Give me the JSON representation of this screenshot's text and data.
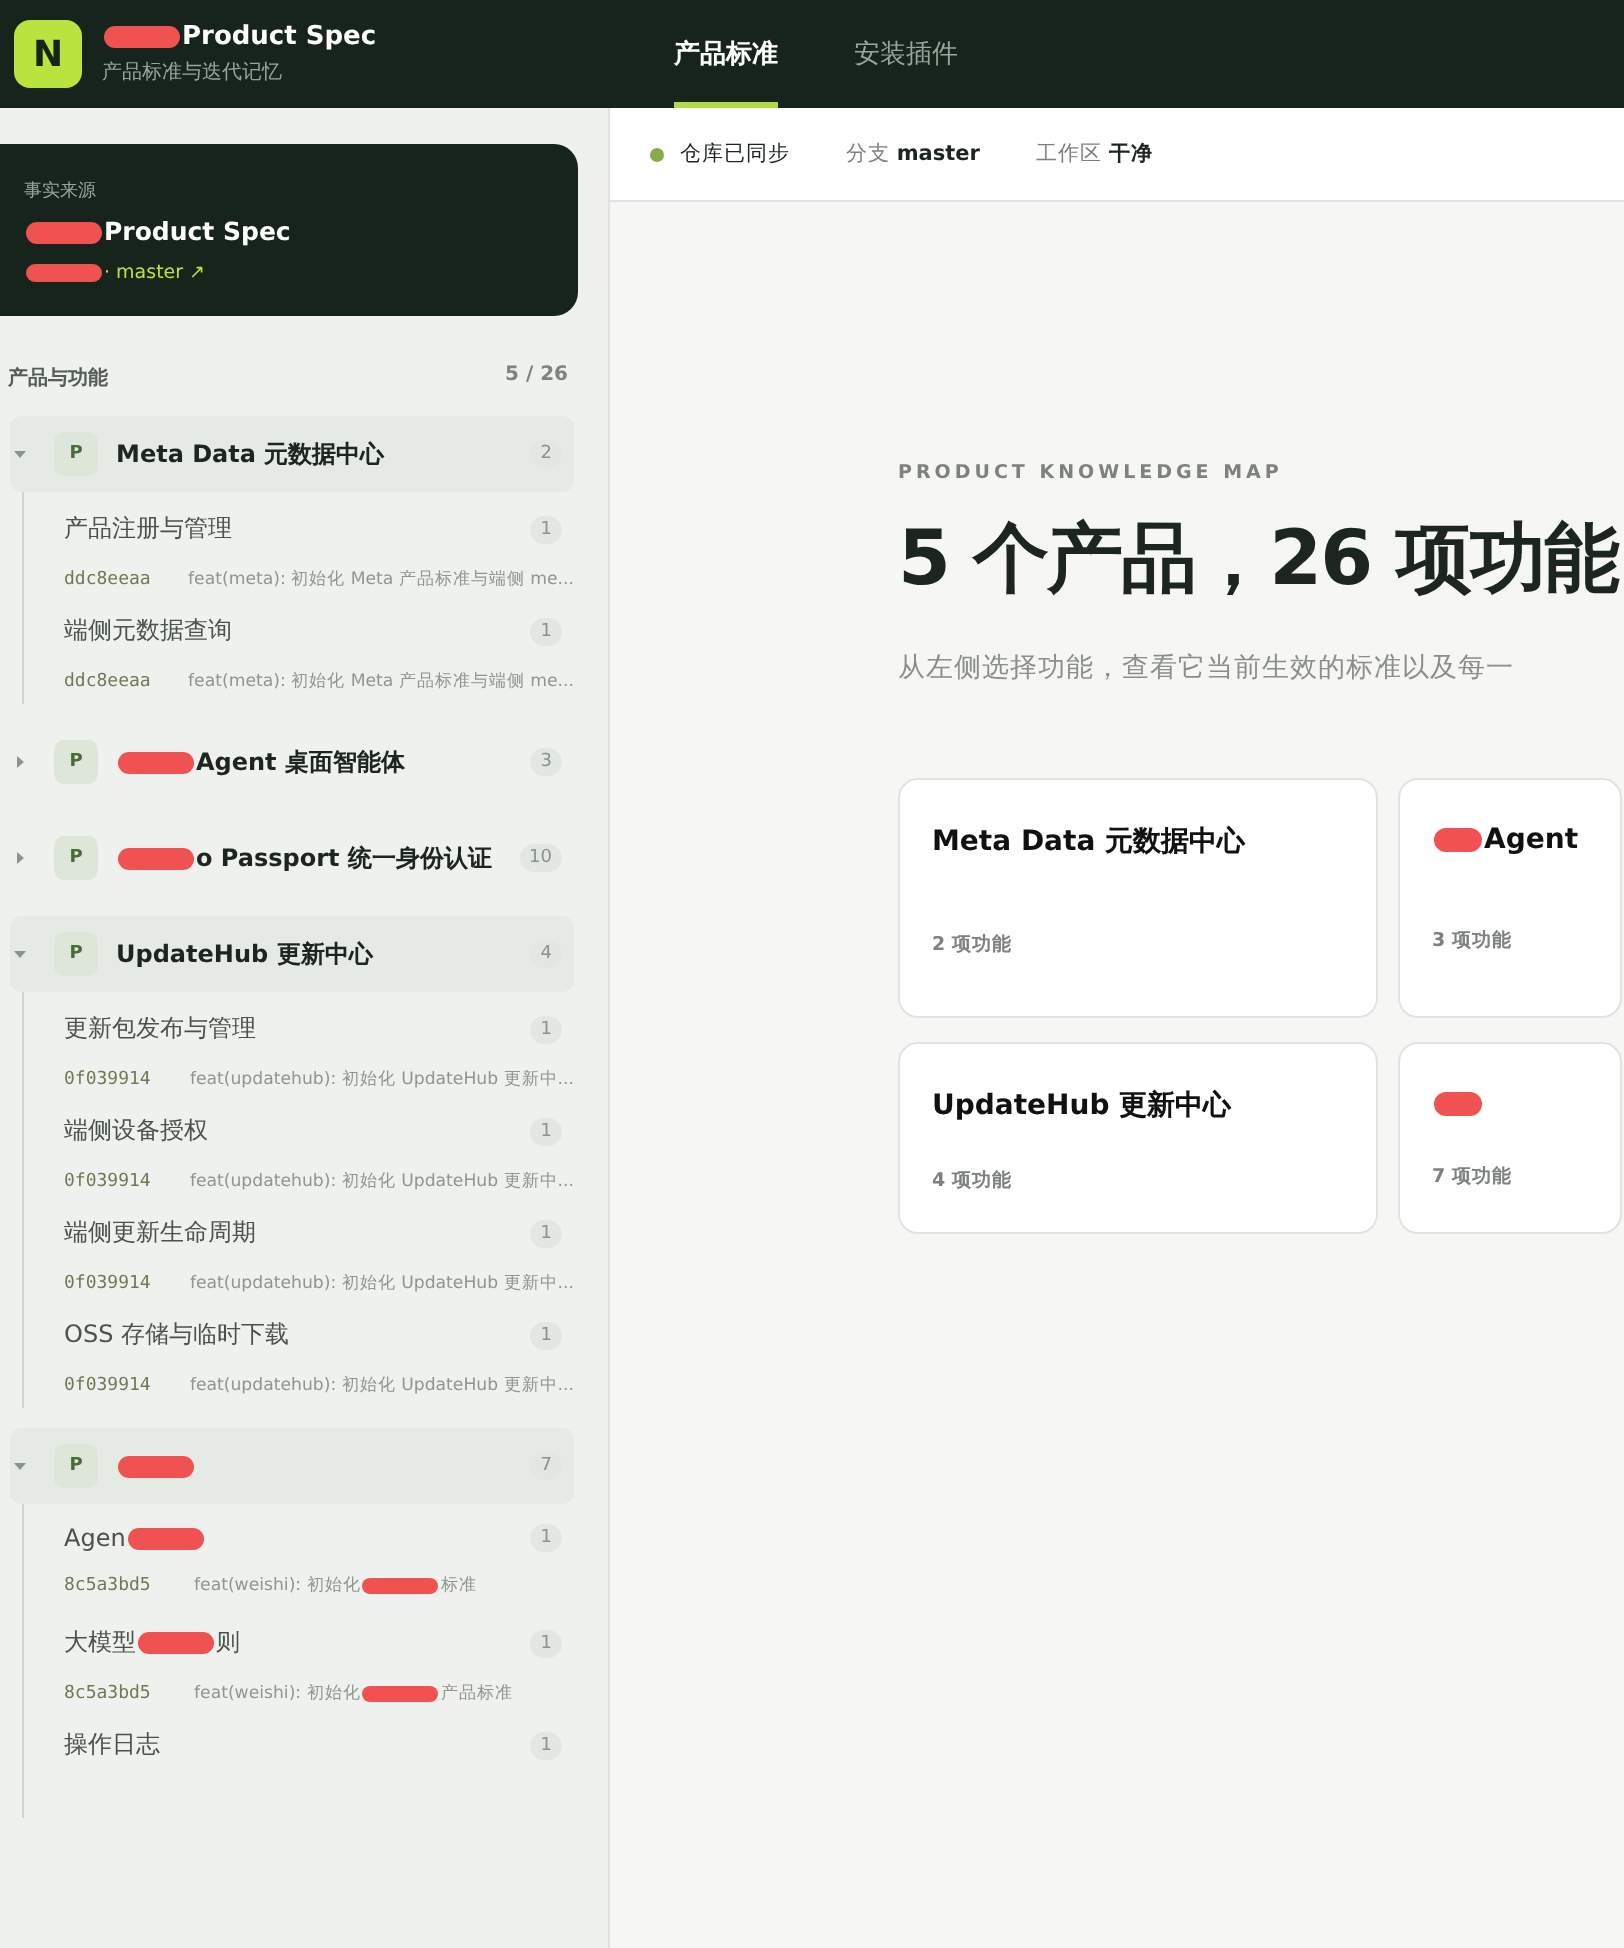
{
  "header": {
    "logo": "N",
    "title": [
      {
        "kind": "redaction"
      },
      "Product Spec"
    ],
    "subtitle": "产品标准与迭代记忆"
  },
  "tabs": [
    {
      "label": "产品标准",
      "selected": true
    },
    {
      "label": "安装插件",
      "selected": false
    }
  ],
  "source_card": {
    "label": "事实来源",
    "title": [
      {
        "kind": "redaction"
      },
      "Product Spec"
    ],
    "branch": [
      {
        "kind": "redaction"
      },
      "· master ↗"
    ]
  },
  "tree_header": {
    "title": "产品与功能",
    "count": "5 / 26"
  },
  "products": [
    {
      "badge": "P",
      "name": [
        "Meta Data 元数据中心"
      ],
      "count": "2",
      "expanded": true,
      "children": [
        {
          "name": [
            "产品注册与管理"
          ],
          "count": "1",
          "hash": "ddc8eeaa",
          "message": [
            "feat(meta): 初始化 Meta 产品标准与端侧 me..."
          ]
        },
        {
          "name": [
            "端侧元数据查询"
          ],
          "count": "1",
          "hash": "ddc8eeaa",
          "message": [
            "feat(meta): 初始化 Meta 产品标准与端侧 me..."
          ]
        }
      ]
    },
    {
      "badge": "P",
      "name": [
        {
          "kind": "redaction"
        },
        "Agent 桌面智能体"
      ],
      "count": "3",
      "expanded": false
    },
    {
      "badge": "P",
      "name": [
        {
          "kind": "redaction"
        },
        "o Passport 统一身份认证"
      ],
      "count": "10",
      "expanded": false
    },
    {
      "badge": "P",
      "name": [
        "UpdateHub 更新中心"
      ],
      "count": "4",
      "expanded": true,
      "children": [
        {
          "name": [
            "更新包发布与管理"
          ],
          "count": "1",
          "hash": "0f039914",
          "message": [
            "feat(updatehub): 初始化 UpdateHub 更新中..."
          ]
        },
        {
          "name": [
            "端侧设备授权"
          ],
          "count": "1",
          "hash": "0f039914",
          "message": [
            "feat(updatehub): 初始化 UpdateHub 更新中..."
          ]
        },
        {
          "name": [
            "端侧更新生命周期"
          ],
          "count": "1",
          "hash": "0f039914",
          "message": [
            "feat(updatehub): 初始化 UpdateHub 更新中..."
          ]
        },
        {
          "name": [
            "OSS 存储与临时下载"
          ],
          "count": "1",
          "hash": "0f039914",
          "message": [
            "feat(updatehub): 初始化 UpdateHub 更新中..."
          ]
        }
      ]
    },
    {
      "badge": "P",
      "name": [
        {
          "kind": "redaction"
        }
      ],
      "count": "7",
      "expanded": true,
      "children": [
        {
          "name": [
            "Agen",
            {
              "kind": "redaction"
            }
          ],
          "count": "1",
          "hash": "8c5a3bd5",
          "message": [
            "feat(weishi): 初始化",
            {
              "kind": "redaction"
            },
            "标准"
          ]
        },
        {
          "name": [
            "大模型",
            {
              "kind": "redaction"
            },
            "则"
          ],
          "count": "1",
          "hash": "8c5a3bd5",
          "message": [
            "feat(weishi): 初始化",
            {
              "kind": "redaction"
            },
            "产品标准"
          ]
        },
        {
          "name": [
            "操作日志"
          ],
          "count": "1"
        }
      ]
    }
  ],
  "status_bar": {
    "synced": true,
    "sync_label": "仓库已同步",
    "branch_label": "分支",
    "branch": "master",
    "workspace_label": "工作区",
    "workspace": "干净"
  },
  "hero": {
    "eyebrow": "PRODUCT KNOWLEDGE MAP",
    "title": "5 个产品，26 项功能",
    "subtitle": "从左侧选择功能，查看它当前生效的标准以及每一"
  },
  "cards": [
    {
      "title": [
        "Meta Data 元数据中心"
      ],
      "meta": "2 项功能"
    },
    {
      "title": [
        {
          "kind": "redaction"
        },
        "Agent"
      ],
      "meta": "3 项功能"
    },
    {
      "title": [
        "UpdateHub 更新中心"
      ],
      "meta": "4 项功能"
    },
    {
      "title": [
        {
          "kind": "redaction"
        }
      ],
      "meta": "7 项功能"
    }
  ]
}
